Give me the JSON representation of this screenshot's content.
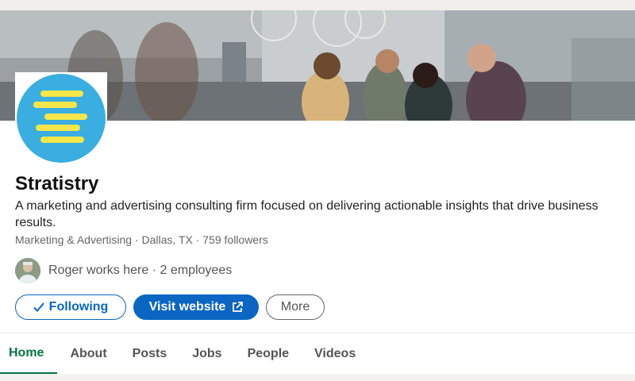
{
  "company": {
    "name": "Stratistry",
    "tagline": "A marketing and advertising consulting firm focused on delivering actionable insights that drive business results.",
    "meta": "Marketing & Advertising · Dallas, TX · 759 followers",
    "employees_text": "Roger works here · 2 employees"
  },
  "actions": {
    "following_label": "Following",
    "visit_label": "Visit website",
    "more_label": "More"
  },
  "tabs": [
    {
      "label": "Home",
      "active": true
    },
    {
      "label": "About"
    },
    {
      "label": "Posts"
    },
    {
      "label": "Jobs"
    },
    {
      "label": "People"
    },
    {
      "label": "Videos"
    }
  ],
  "colors": {
    "accent": "#0a66c2",
    "active_tab": "#057642",
    "logo_bg": "#3aaee0",
    "logo_stripes": "#f5e64a"
  },
  "icons": {
    "following": "check-icon",
    "visit": "external-link-icon"
  }
}
